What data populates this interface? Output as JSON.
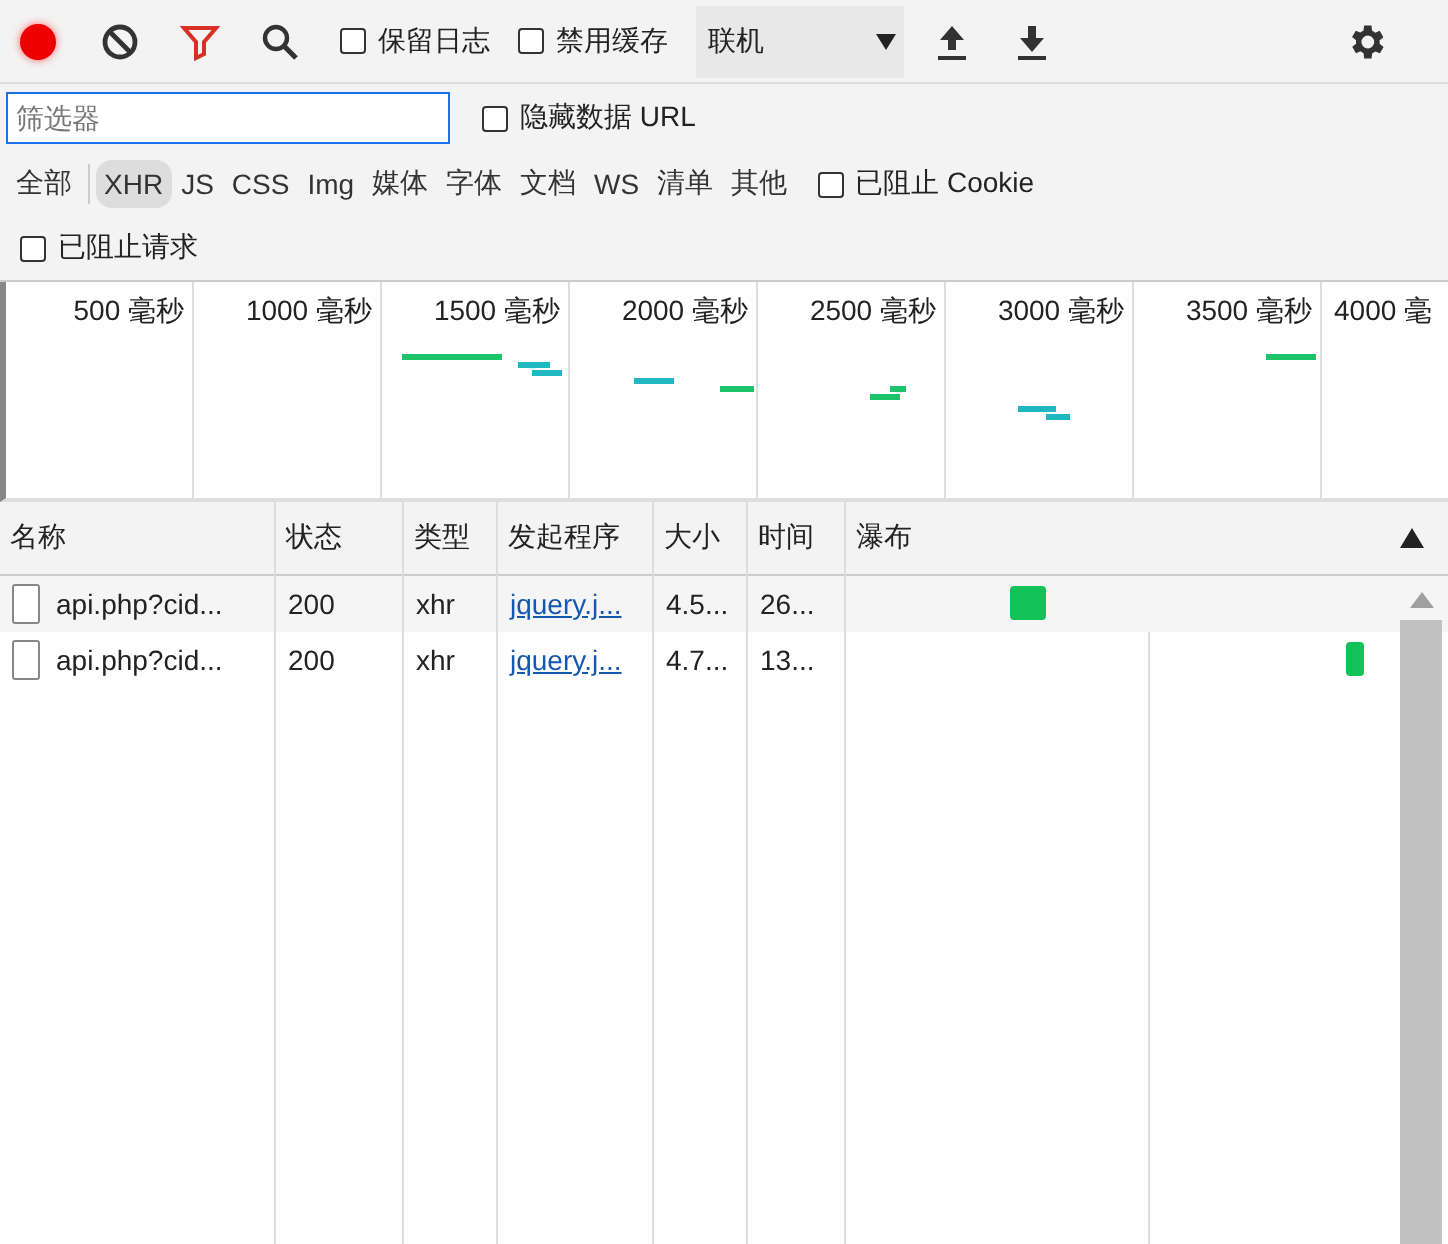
{
  "toolbar": {
    "preserve_log": {
      "label": "保留日志",
      "checked": false
    },
    "disable_cache": {
      "label": "禁用缓存",
      "checked": false
    },
    "throttling": {
      "value": "联机"
    }
  },
  "filter": {
    "placeholder": "筛选器",
    "hide_data_urls": {
      "label": "隐藏数据 URL",
      "checked": false
    }
  },
  "types": [
    {
      "label": "全部",
      "selected": false
    },
    {
      "label": "XHR",
      "selected": true
    },
    {
      "label": "JS",
      "selected": false
    },
    {
      "label": "CSS",
      "selected": false
    },
    {
      "label": "Img",
      "selected": false
    },
    {
      "label": "媒体",
      "selected": false
    },
    {
      "label": "字体",
      "selected": false
    },
    {
      "label": "文档",
      "selected": false
    },
    {
      "label": "WS",
      "selected": false
    },
    {
      "label": "清单",
      "selected": false
    },
    {
      "label": "其他",
      "selected": false
    }
  ],
  "blocked_cookies": {
    "label": "已阻止 Cookie",
    "checked": false
  },
  "blocked_requests": {
    "label": "已阻止请求",
    "checked": false
  },
  "overview": {
    "ticks": [
      "500 毫秒",
      "1000 毫秒",
      "1500 毫秒",
      "2000 毫秒",
      "2500 毫秒",
      "3000 毫秒",
      "3500 毫秒",
      "4000 毫"
    ]
  },
  "table": {
    "columns": [
      "名称",
      "状态",
      "类型",
      "发起程序",
      "大小",
      "时间",
      "瀑布"
    ],
    "rows": [
      {
        "name": "api.php?cid...",
        "status": "200",
        "type": "xhr",
        "initiator": "jquery.j...",
        "size": "4.5...",
        "time": "26..."
      },
      {
        "name": "api.php?cid...",
        "status": "200",
        "type": "xhr",
        "initiator": "jquery.j...",
        "size": "4.7...",
        "time": "13..."
      }
    ]
  }
}
